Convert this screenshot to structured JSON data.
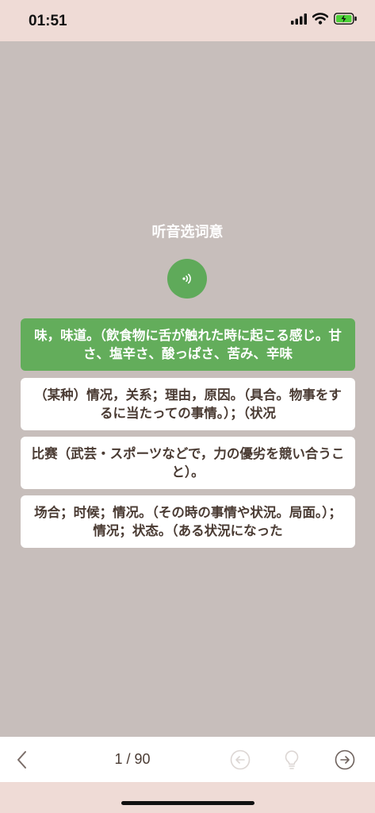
{
  "status": {
    "time": "01:51"
  },
  "question": {
    "prompt": "听音选词意"
  },
  "options": [
    {
      "text": "味，味道。（飲食物に舌が触れた時に起こる感じ。甘さ、塩辛さ、酸っぱさ、苦み、辛味",
      "selected": true
    },
    {
      "text": "（某种）情况，关系；理由，原因。（具合。物事をするに当たっての事情。）；（状况",
      "selected": false
    },
    {
      "text": "比赛（武芸・スポーツなどで，力の優劣を競い合うこと）。",
      "selected": false
    },
    {
      "text": "场合；时候；情况。（その時の事情や状況。局面。）；情况；状态。（ある状況になった",
      "selected": false
    }
  ],
  "footer": {
    "counter": "1 / 90"
  },
  "colors": {
    "accent": "#63ad5b",
    "background": "#c7bebb",
    "status_bar": "#efdbd6"
  },
  "icons": [
    "back-arrow-icon",
    "audio-icon",
    "previous-circle-icon",
    "hint-bulb-icon",
    "next-circle-icon",
    "signal-icon",
    "wifi-icon",
    "battery-icon"
  ]
}
